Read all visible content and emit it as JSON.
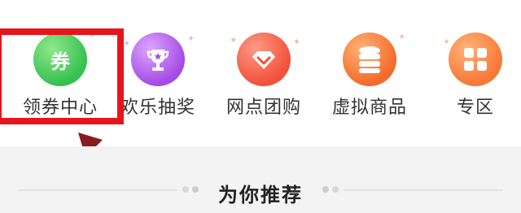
{
  "entries": [
    {
      "label": "领券中心",
      "icon": "coupon-icon",
      "badge_text": "券",
      "color": "#36c04f"
    },
    {
      "label": "欢乐抽奖",
      "icon": "trophy-icon",
      "color": "#a64be5"
    },
    {
      "label": "网点团购",
      "icon": "diamond-icon",
      "color": "#f2503a"
    },
    {
      "label": "虚拟商品",
      "icon": "database-icon",
      "color": "#f46a2b"
    },
    {
      "label": "专区",
      "icon": "grid-icon",
      "color": "#f97836"
    }
  ],
  "recommend": {
    "title": "为你推荐"
  },
  "annotation": {
    "highlight_color": "#e8141b",
    "arrow_color": "#8b1a1f"
  }
}
